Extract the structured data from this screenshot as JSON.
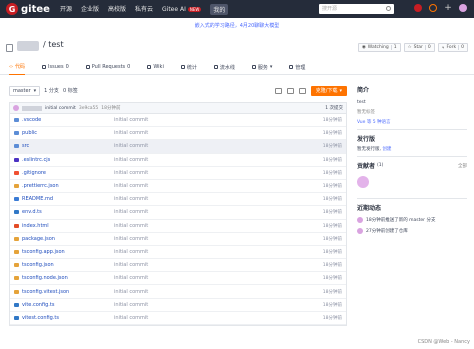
{
  "topbar": {
    "logo": "gitee",
    "nav": [
      "开源",
      "企业版",
      "高校版",
      "私有云"
    ],
    "ai_label": "Gitee AI",
    "ai_badge": "NEW",
    "me": "我的",
    "search_placeholder": "搜开源"
  },
  "banner": "嵌入式的学习路径，4月20聊聊大模型",
  "repo": {
    "name": "/ test",
    "watching": "Watching",
    "watching_count": "1",
    "star": "Star",
    "star_count": "0",
    "fork": "Fork",
    "fork_count": "0"
  },
  "tabs": [
    {
      "label": "代码",
      "active": true
    },
    {
      "label": "Issues",
      "count": "0"
    },
    {
      "label": "Pull Requests",
      "count": "0"
    },
    {
      "label": "Wiki"
    },
    {
      "label": "统计"
    },
    {
      "label": "流水线"
    },
    {
      "label": "服务"
    },
    {
      "label": "管理"
    }
  ],
  "toolbar": {
    "branch": "master",
    "branches": "1 分支",
    "tags": "0 标签",
    "clone": "克隆/下载"
  },
  "commit": {
    "message": "initial commit",
    "hash": "3e9ca55",
    "time": "18分钟前",
    "count": "1 次提交"
  },
  "files": [
    {
      "name": ".vscode",
      "type": "folder",
      "msg": "initial commit",
      "time": "18分钟前"
    },
    {
      "name": "public",
      "type": "folder",
      "msg": "initial commit",
      "time": "18分钟前"
    },
    {
      "name": "src",
      "type": "folder",
      "msg": "initial commit",
      "time": "18分钟前",
      "highlight": true
    },
    {
      "name": ".eslintrc.cjs",
      "type": "cfg",
      "msg": "initial commit",
      "time": "18分钟前"
    },
    {
      "name": ".gitignore",
      "type": "git",
      "msg": "initial commit",
      "time": "18分钟前"
    },
    {
      "name": ".prettierrc.json",
      "type": "json",
      "msg": "initial commit",
      "time": "18分钟前"
    },
    {
      "name": "README.md",
      "type": "md",
      "msg": "initial commit",
      "time": "18分钟前"
    },
    {
      "name": "env.d.ts",
      "type": "ts",
      "msg": "initial commit",
      "time": "18分钟前"
    },
    {
      "name": "index.html",
      "type": "html",
      "msg": "initial commit",
      "time": "18分钟前"
    },
    {
      "name": "package.json",
      "type": "json",
      "msg": "initial commit",
      "time": "18分钟前"
    },
    {
      "name": "tsconfig.app.json",
      "type": "json",
      "msg": "initial commit",
      "time": "18分钟前"
    },
    {
      "name": "tsconfig.json",
      "type": "json",
      "msg": "initial commit",
      "time": "18分钟前"
    },
    {
      "name": "tsconfig.node.json",
      "type": "json",
      "msg": "initial commit",
      "time": "18分钟前"
    },
    {
      "name": "tsconfig.vitest.json",
      "type": "json",
      "msg": "initial commit",
      "time": "18分钟前"
    },
    {
      "name": "vite.config.ts",
      "type": "ts",
      "msg": "initial commit",
      "time": "18分钟前"
    },
    {
      "name": "vitest.config.ts",
      "type": "ts",
      "msg": "initial commit",
      "time": "18分钟前"
    }
  ],
  "sidebar": {
    "intro_title": "简介",
    "intro_text": "test",
    "no_tags": "暂无标签",
    "lang": "Vue 等 5 种语言",
    "release_title": "发行版",
    "release_none": "暂无发行版,",
    "release_create": "创建",
    "contrib_title": "贡献者",
    "contrib_count": "(1)",
    "contrib_all": "全部",
    "activity_title": "近期动态",
    "activities": [
      "18分钟前推送了新的 master 分支",
      "27分钟前创建了仓库"
    ]
  },
  "watermark": "CSDN @Web - Nancy"
}
